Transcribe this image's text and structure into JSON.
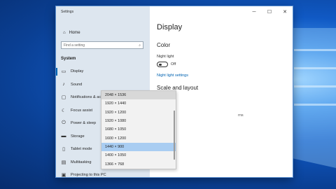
{
  "window": {
    "title": "Settings"
  },
  "sidebar": {
    "home": "Home",
    "search_placeholder": "Find a setting",
    "section": "System",
    "items": [
      {
        "label": "Display",
        "icon": "monitor-icon"
      },
      {
        "label": "Sound",
        "icon": "speaker-icon"
      },
      {
        "label": "Notifications & actions",
        "icon": "notifications-icon"
      },
      {
        "label": "Focus assist",
        "icon": "moon-icon"
      },
      {
        "label": "Power & sleep",
        "icon": "power-icon"
      },
      {
        "label": "Storage",
        "icon": "storage-icon"
      },
      {
        "label": "Tablet mode",
        "icon": "tablet-icon"
      },
      {
        "label": "Multitasking",
        "icon": "multitasking-icon"
      },
      {
        "label": "Projecting to this PC",
        "icon": "projecting-icon"
      }
    ]
  },
  "content": {
    "title": "Display",
    "color_heading": "Color",
    "night_light_label": "Night light",
    "night_light_state": "Off",
    "night_light_link": "Night light settings",
    "scale_heading": "Scale and layout",
    "partial_text": "rns"
  },
  "resolution_dropdown": {
    "options": [
      "2048 × 1536",
      "1920 × 1440",
      "1920 × 1200",
      "1920 × 1080",
      "1680 × 1050",
      "1600 × 1200",
      "1440 × 900",
      "1400 × 1050",
      "1366 × 768"
    ],
    "selected": "1440 × 900"
  },
  "colors": {
    "accent": "#0063b1",
    "sidebar_bg": "#dde6ef",
    "selected_option": "#a9cdf2"
  }
}
